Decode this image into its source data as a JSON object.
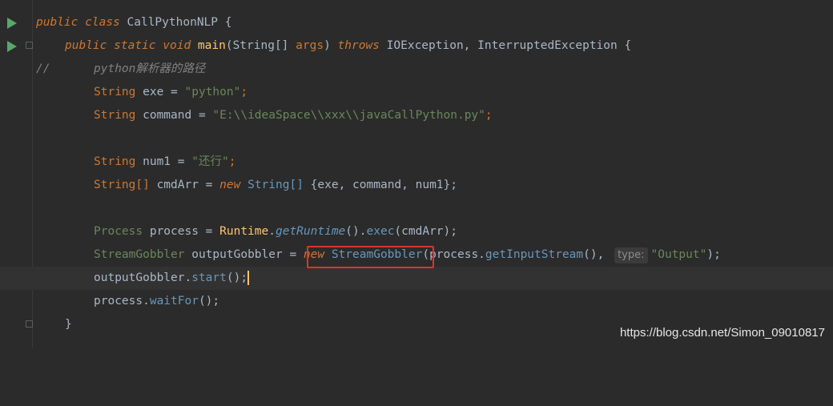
{
  "lines": [
    {
      "l1_kw1": "public",
      "l1_kw2": "class",
      "l1_name": "CallPythonNLP",
      "l1_brace": " {"
    },
    {
      "l2_kw1": "public",
      "l2_kw2": "static",
      "l2_kw3": "void",
      "l2_fn": "main",
      "l2_p1": "(",
      "l2_type": "String[]",
      "l2_arg": " args",
      "l2_p2": ")",
      "l2_kw4": "throws",
      "l2_ex": "IOException, InterruptedException {"
    },
    {
      "comment_prefix": "//",
      "comment_text": "python解析器的路径"
    },
    {
      "type": "String",
      "rest": " exe = ",
      "str": "\"python\"",
      "end": ";"
    },
    {
      "type": "String",
      "rest": " command = ",
      "str": "\"E:\\\\ideaSpace\\\\xxx\\\\javaCallPython.py\"",
      "end": ";"
    },
    {
      "type": "String",
      "rest": " num1 = ",
      "str": "\"还行\"",
      "end": ";"
    },
    {
      "type": "String[]",
      "rest": " cmdArr = ",
      "kw": "new",
      "type2": "String[]",
      "end": " {exe, command, num1};"
    },
    {
      "type": "Process",
      "rest": " process = ",
      "cls": "Runtime",
      "dot": ".",
      "m1": "getRuntime",
      "m1p": "().",
      "m2": "exec",
      "end": "(cmdArr);"
    },
    {
      "type": "StreamGobbler",
      "rest": " outputGobbler = ",
      "kw": "new",
      "cls": "StreamGobbler",
      "p1": "(process.",
      "m": "getInputStream",
      "p2": "(),",
      "hint": "type:",
      "str": "\"Output\"",
      "end": ");"
    },
    {
      "obj": "outputGobbler.",
      "m": "start",
      "end": "();"
    },
    {
      "obj": "process.",
      "m": "waitFor",
      "end": "();"
    },
    {
      "brace": "}"
    }
  ],
  "watermark": "https://blog.csdn.net/Simon_09010817"
}
